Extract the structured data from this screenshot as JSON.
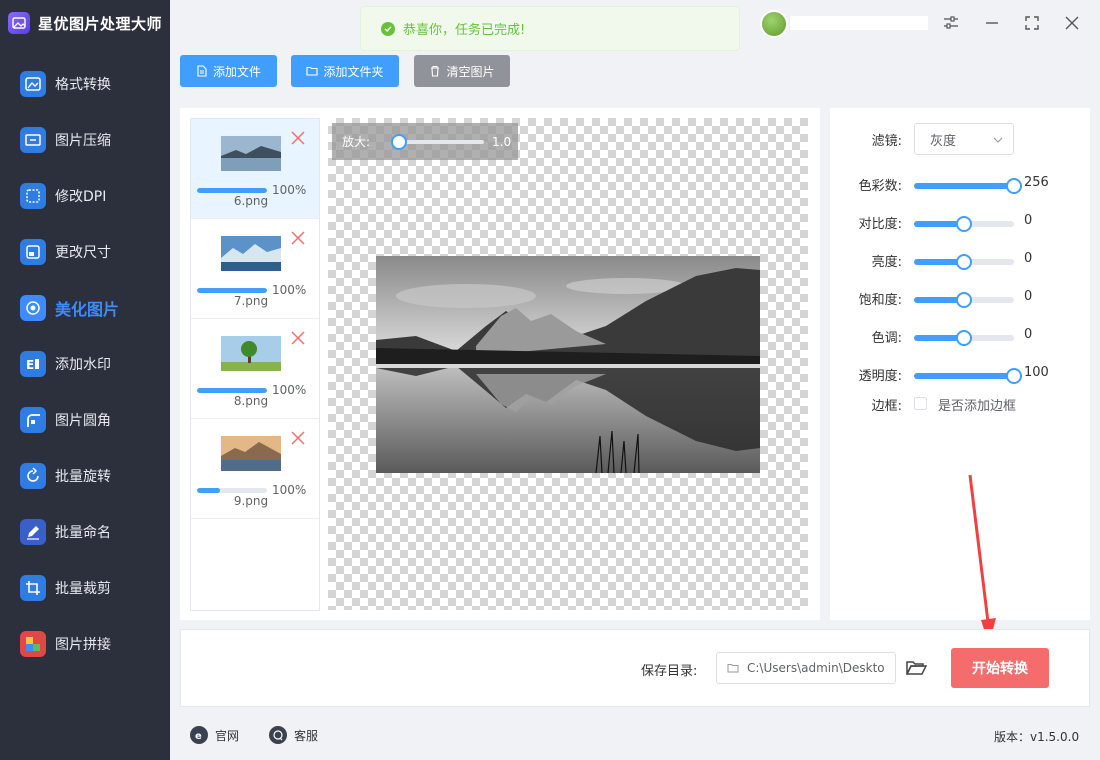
{
  "app": {
    "title": "星优图片处理大师"
  },
  "sidebar": {
    "items": [
      {
        "label": "格式转换",
        "icon": "image-convert-icon",
        "color": "#2f7de1"
      },
      {
        "label": "图片压缩",
        "icon": "image-compress-icon",
        "color": "#2f7de1"
      },
      {
        "label": "修改DPI",
        "icon": "dpi-icon",
        "color": "#2f7de1"
      },
      {
        "label": "更改尺寸",
        "icon": "resize-icon",
        "color": "#2f7de1"
      },
      {
        "label": "美化图片",
        "icon": "beautify-icon",
        "color": "#3d8bff",
        "active": true
      },
      {
        "label": "添加水印",
        "icon": "watermark-icon",
        "color": "#2f7de1"
      },
      {
        "label": "图片圆角",
        "icon": "round-corner-icon",
        "color": "#2f7de1"
      },
      {
        "label": "批量旋转",
        "icon": "rotate-icon",
        "color": "#2f7de1"
      },
      {
        "label": "批量命名",
        "icon": "rename-icon",
        "color": "#3a5fc8"
      },
      {
        "label": "批量裁剪",
        "icon": "crop-icon",
        "color": "#2f7de1"
      },
      {
        "label": "图片拼接",
        "icon": "puzzle-icon",
        "color": "#e04848"
      }
    ]
  },
  "toast": {
    "message": "恭喜你，任务已完成!"
  },
  "toolbar": {
    "add_file": "添加文件",
    "add_folder": "添加文件夹",
    "clear": "清空图片"
  },
  "files": [
    {
      "name": "6.png",
      "progress_text": "100%",
      "progress": 1.0,
      "selected": true
    },
    {
      "name": "7.png",
      "progress_text": "100%",
      "progress": 1.0,
      "selected": false
    },
    {
      "name": "8.png",
      "progress_text": "100%",
      "progress": 1.0,
      "selected": false
    },
    {
      "name": "9.png",
      "progress_text": "100%",
      "progress": 0.33,
      "selected": false
    }
  ],
  "zoom": {
    "label": "放大:",
    "value": "1.0",
    "level": 0.05
  },
  "settings": {
    "filter_label": "滤镜:",
    "filter_value": "灰度",
    "sliders": [
      {
        "label": "色彩数:",
        "value": "256",
        "level": 1.0
      },
      {
        "label": "对比度:",
        "value": "0",
        "level": 0.5
      },
      {
        "label": "亮度:",
        "value": "0",
        "level": 0.5
      },
      {
        "label": "饱和度:",
        "value": "0",
        "level": 0.5
      },
      {
        "label": "色调:",
        "value": "0",
        "level": 0.5
      },
      {
        "label": "透明度:",
        "value": "100",
        "level": 1.0
      }
    ],
    "border_label": "边框:",
    "border_checkbox_label": "是否添加边框",
    "border_checked": false
  },
  "output": {
    "save_label": "保存目录:",
    "path": "C:\\Users\\admin\\Deskto",
    "start_button": "开始转换"
  },
  "footer": {
    "website": "官网",
    "support": "客服",
    "version": "版本：v1.5.0.0"
  },
  "colors": {
    "primary": "#409eff",
    "danger": "#f56c6c",
    "success": "#67c23a",
    "sidebar_bg": "#2b303c"
  }
}
